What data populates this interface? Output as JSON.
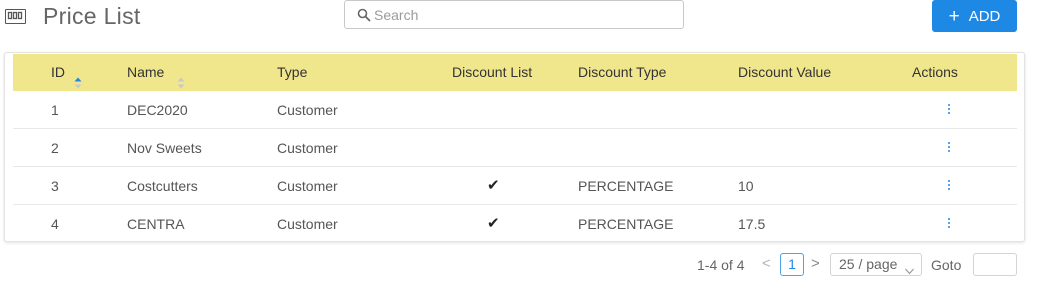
{
  "header": {
    "title": "Price List",
    "icon": "list-view-icon"
  },
  "search": {
    "placeholder": "Search",
    "value": "",
    "icon": "search-icon"
  },
  "add_button": {
    "plus": "+",
    "label": "ADD",
    "color": "#1e88e5"
  },
  "table": {
    "header_color": "#f0e68c",
    "columns": [
      {
        "key": "id",
        "label": "ID",
        "sorted": "ascending"
      },
      {
        "key": "name",
        "label": "Name",
        "sorted": "none"
      },
      {
        "key": "type",
        "label": "Type"
      },
      {
        "key": "discount_list",
        "label": "Discount List"
      },
      {
        "key": "discount_type",
        "label": "Discount Type"
      },
      {
        "key": "discount_value",
        "label": "Discount Value"
      },
      {
        "key": "actions",
        "label": "Actions"
      }
    ],
    "rows": [
      {
        "id": "1",
        "name": "DEC2020",
        "type": "Customer",
        "discount_list": "",
        "discount_type": "",
        "discount_value": ""
      },
      {
        "id": "2",
        "name": "Nov Sweets",
        "type": "Customer",
        "discount_list": "",
        "discount_type": "",
        "discount_value": ""
      },
      {
        "id": "3",
        "name": "Costcutters",
        "type": "Customer",
        "discount_list": "✔",
        "discount_type": "PERCENTAGE",
        "discount_value": "10"
      },
      {
        "id": "4",
        "name": "CENTRA",
        "type": "Customer",
        "discount_list": "✔",
        "discount_type": "PERCENTAGE",
        "discount_value": "17.5"
      }
    ]
  },
  "pagination": {
    "range": "1-4 of 4",
    "prev": "<",
    "current_page": "1",
    "next": ">",
    "page_size": "25 / page",
    "goto_label": "Goto",
    "goto_value": ""
  }
}
